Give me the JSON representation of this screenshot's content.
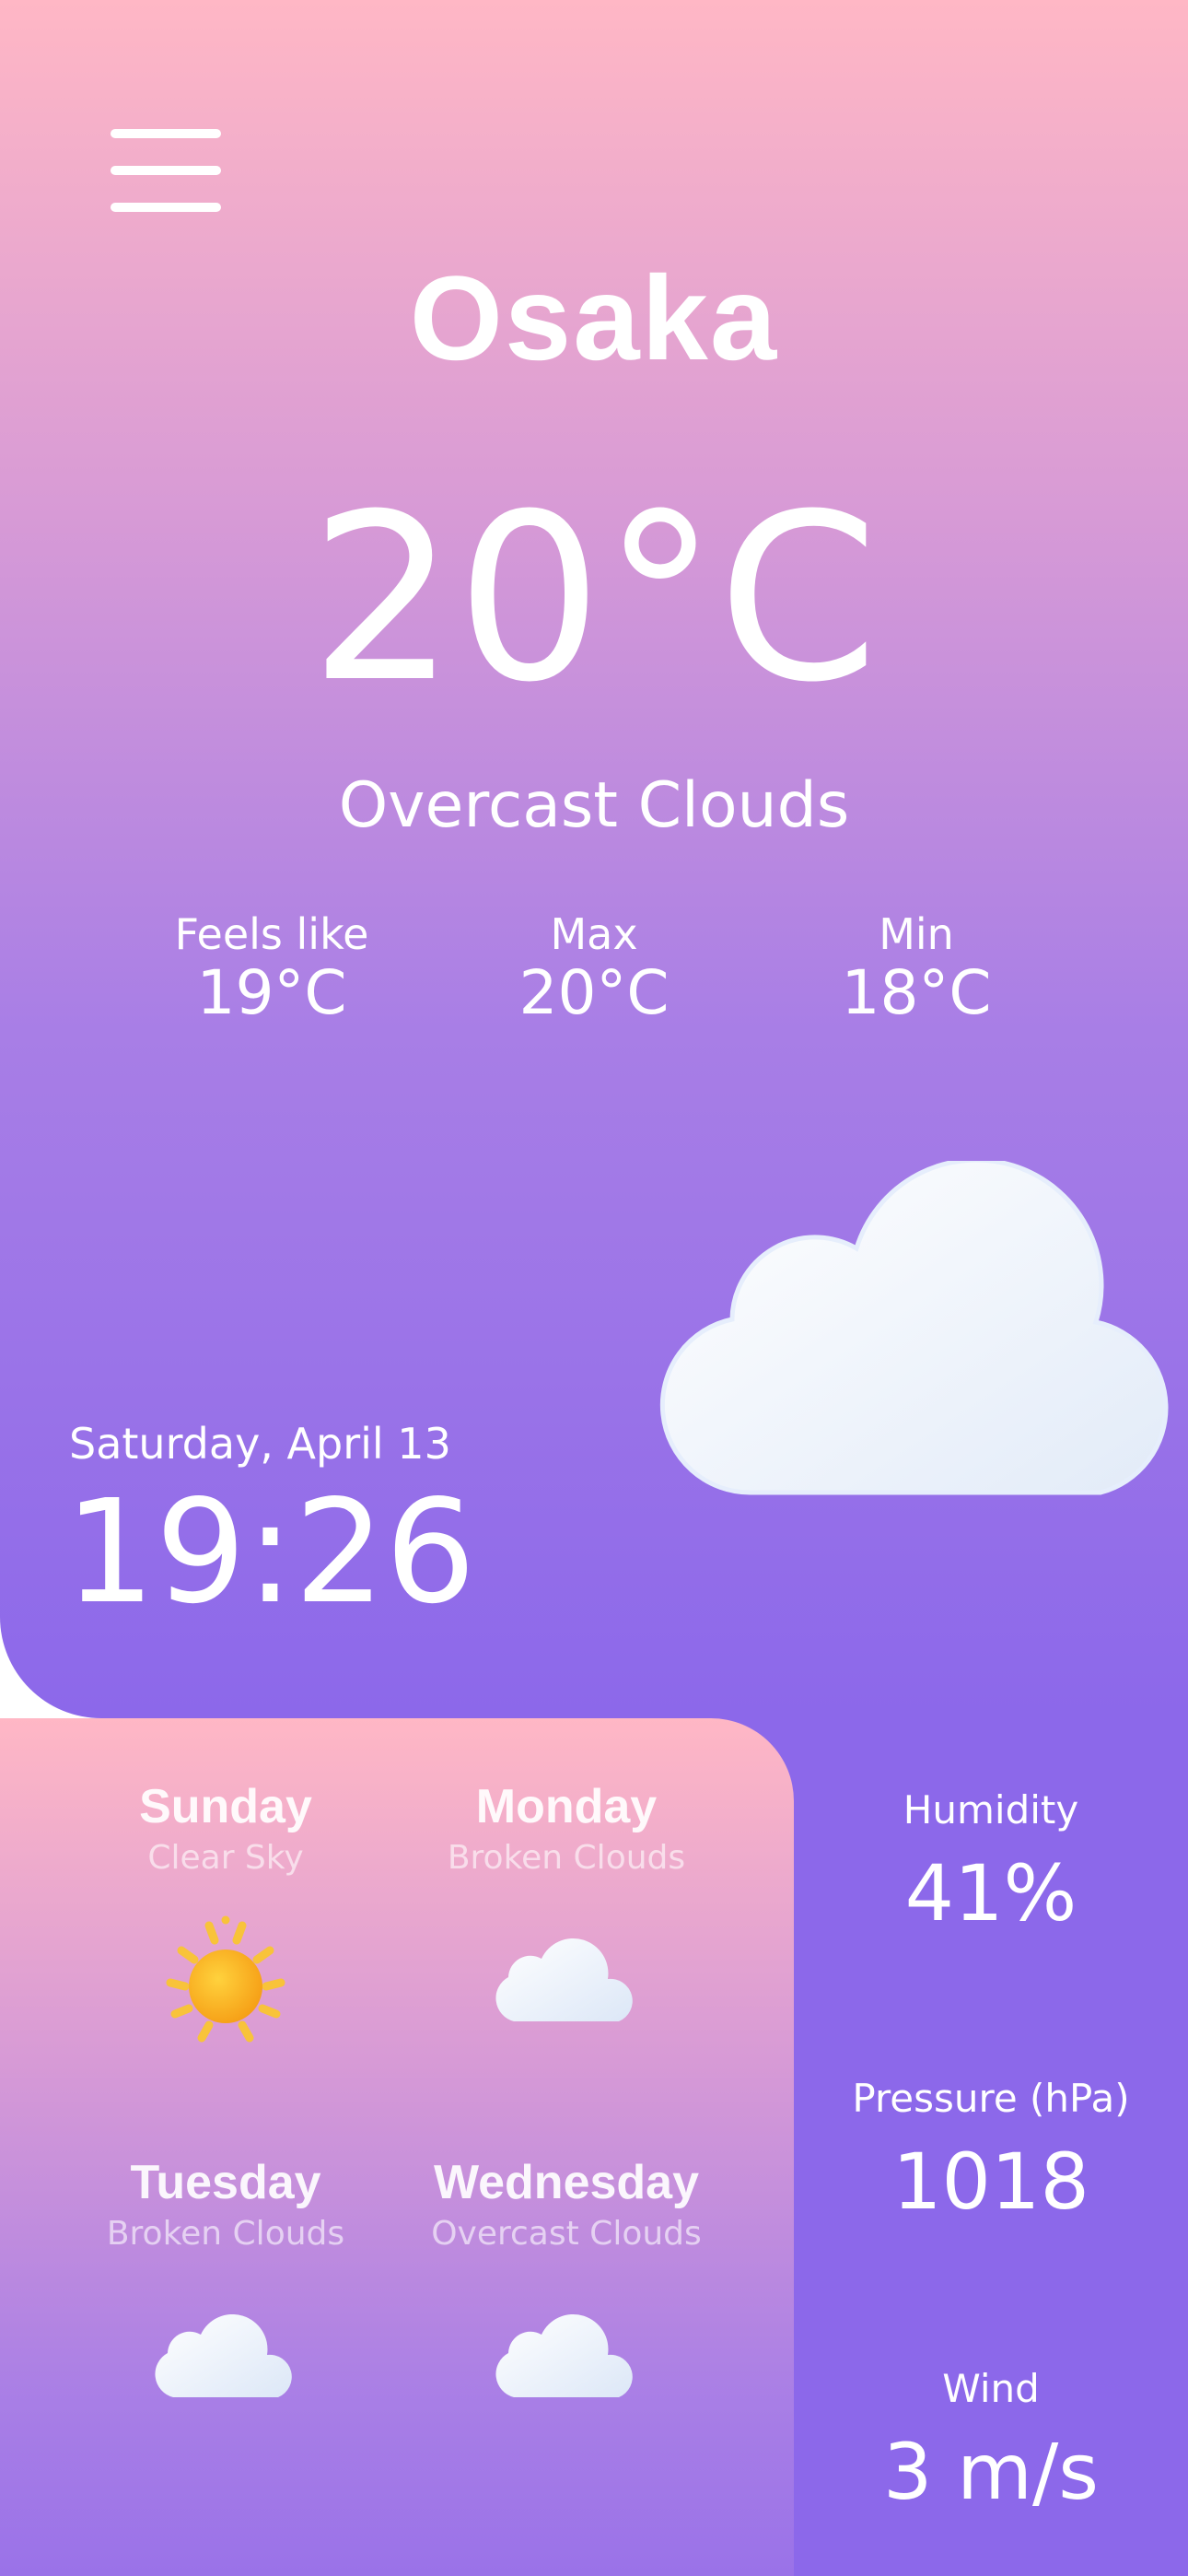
{
  "city": "Osaka",
  "current": {
    "temperature": "20°C",
    "condition": "Overcast Clouds",
    "feels_like": {
      "label": "Feels like",
      "value": "19°C"
    },
    "max": {
      "label": "Max",
      "value": "20°C"
    },
    "min": {
      "label": "Min",
      "value": "18°C"
    },
    "icon": "cloud-icon"
  },
  "datetime": {
    "date": "Saturday, April 13",
    "time": "19:26"
  },
  "forecast": [
    {
      "day": "Sunday",
      "condition": "Clear Sky",
      "icon": "sun-icon"
    },
    {
      "day": "Monday",
      "condition": "Broken Clouds",
      "icon": "cloud-icon"
    },
    {
      "day": "Tuesday",
      "condition": "Broken Clouds",
      "icon": "cloud-icon"
    },
    {
      "day": "Wednesday",
      "condition": "Overcast Clouds",
      "icon": "cloud-icon"
    }
  ],
  "metrics": {
    "humidity": {
      "label": "Humidity",
      "value": "41%"
    },
    "pressure": {
      "label": "Pressure (hPa)",
      "value": "1018"
    },
    "wind": {
      "label": "Wind",
      "value": "3 m/s"
    }
  },
  "colors": {
    "gradient_top": "#ffb7c5",
    "gradient_bottom": "#8c68ea",
    "sun": "#f7b21c"
  },
  "menu_icon": "hamburger-menu-icon"
}
